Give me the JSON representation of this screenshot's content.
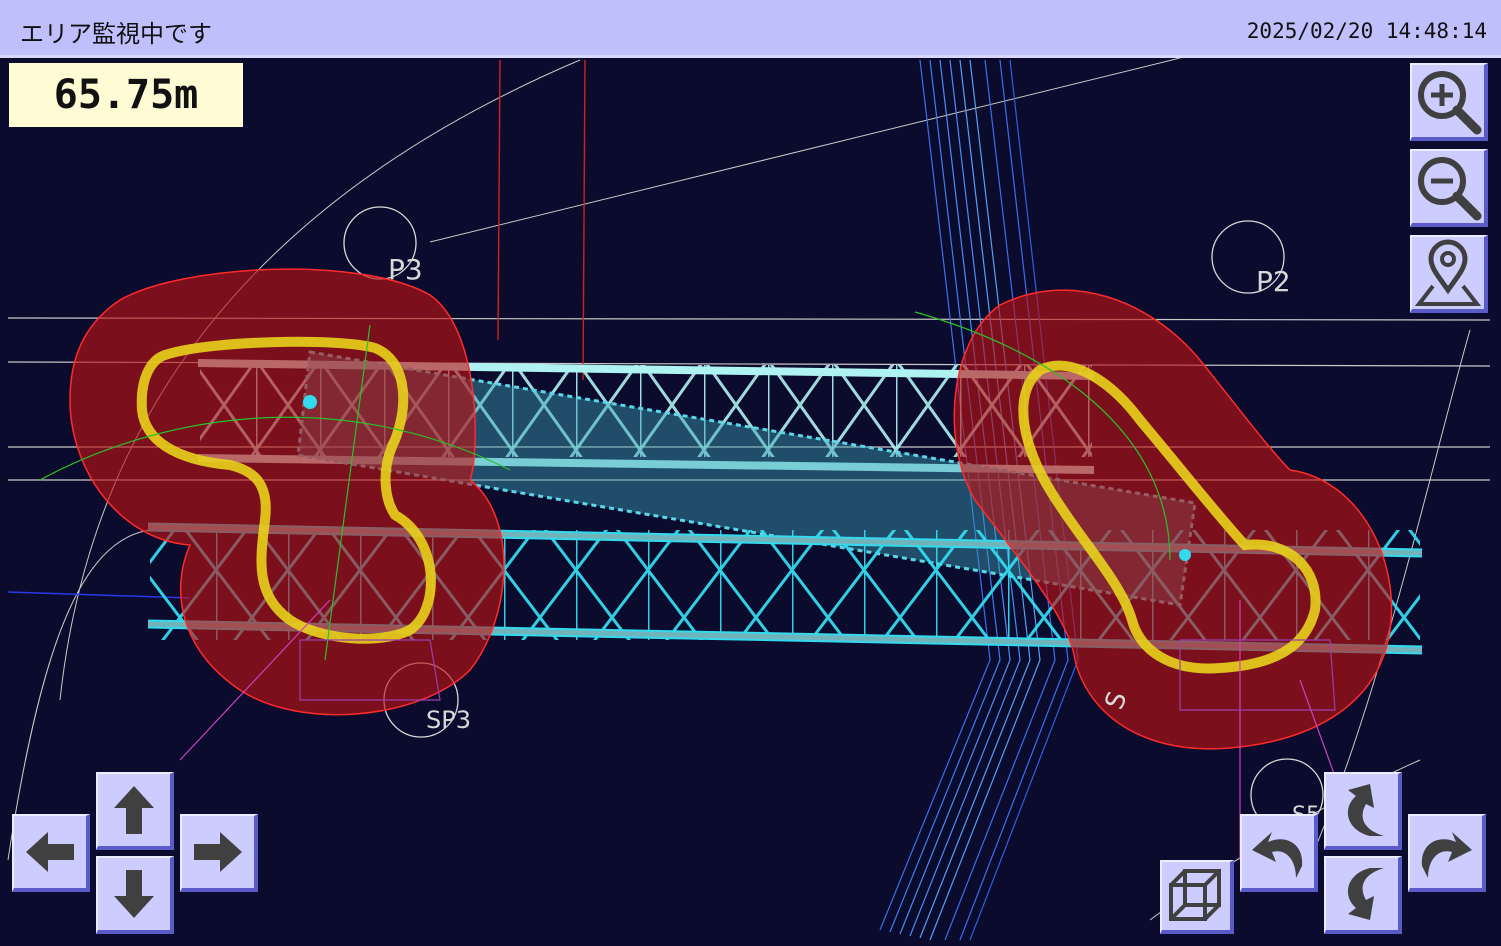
{
  "header": {
    "status_text": "エリア監視中です",
    "datetime": "2025/02/20 14:48:14"
  },
  "distance_readout": "65.75m",
  "map": {
    "labels": {
      "p3": "P3",
      "p2": "P2",
      "sp3": "SP3",
      "s_rot": "S",
      "s5": "S5"
    }
  },
  "controls": {
    "zoom_in_icon": "magnifier-plus-icon",
    "zoom_out_icon": "magnifier-minus-icon",
    "location_icon": "map-pin-icon",
    "pan_icons": [
      "arrow-left-icon",
      "arrow-up-icon",
      "arrow-right-icon",
      "arrow-down-icon"
    ],
    "rotate_icons": [
      "rotate-ccw-icon",
      "rotate-cw-icon",
      "tilt-up-icon",
      "tilt-down-icon"
    ],
    "view_3d_icon": "wireframe-cube-icon"
  },
  "colors": {
    "background": "#0b0b2e",
    "header": "#bfbffc",
    "readout_bg": "#fffbd4",
    "danger_zone": "#d01616",
    "warning_outline": "#e8d21c",
    "truss_light": "#aef2f2",
    "truss_cyan": "#33d9ec",
    "button": "#ccccff",
    "icon": "#404040"
  }
}
